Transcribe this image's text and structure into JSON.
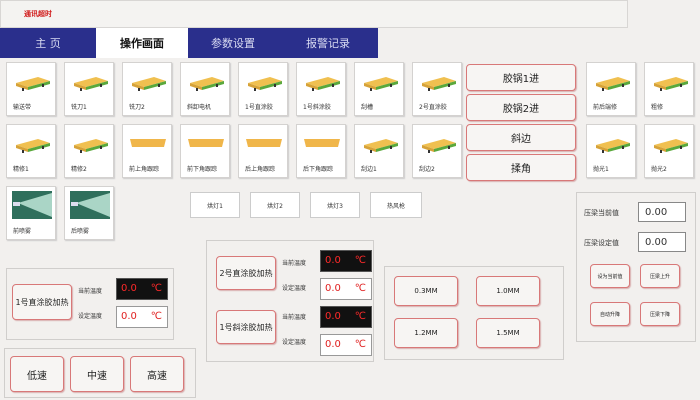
{
  "status": "通讯超时",
  "tabs": [
    "主 页",
    "操作画面",
    "参数设置",
    "报警记录"
  ],
  "tiles_row1": [
    "输送带",
    "铣刀1",
    "铣刀2",
    "斜卸电机",
    "1号直涂胶",
    "1号斜涂胶",
    "刮槽",
    "2号直涂胶"
  ],
  "tiles_row2": [
    "精修1",
    "精修2",
    "前上角跟踪",
    "前下角跟踪",
    "后上角跟踪",
    "后下角跟踪",
    "刮边1",
    "刮边2"
  ],
  "tiles_row3": [
    "前喷雾",
    "后喷雾"
  ],
  "tiles_right": [
    "前后端修",
    "粗修",
    "抛光1",
    "抛光2"
  ],
  "mid_buttons": [
    "胶锅1进",
    "胶锅2进",
    "斜边",
    "揉角"
  ],
  "small_buttons": [
    "烘灯1",
    "烘灯2",
    "烘灯3",
    "热风枪"
  ],
  "heater1": {
    "title": "1号直涂胶加热",
    "cur_label": "当前温度",
    "set_label": "设定温度",
    "cur": "0.0",
    "set": "0.0",
    "unit": "℃"
  },
  "heater2": {
    "title": "2号直涂胶加热",
    "cur_label": "当前温度",
    "set_label": "设定温度",
    "cur": "0.0",
    "set": "0.0",
    "unit": "℃"
  },
  "heater3": {
    "title": "1号斜涂胶加热",
    "cur_label": "当前温度",
    "set_label": "设定温度",
    "cur": "0.0",
    "set": "0.0",
    "unit": "℃"
  },
  "speed": [
    "低速",
    "中速",
    "高速"
  ],
  "thickness": [
    "0.3MM",
    "1.0MM",
    "1.2MM",
    "1.5MM"
  ],
  "pressure": {
    "cur_label": "压梁当前值",
    "cur": "0.00",
    "set_label": "压梁设定值",
    "set": "0.00",
    "buttons": [
      "设为当前值",
      "压梁上升",
      "自动升降",
      "压梁下降"
    ]
  },
  "colors": {
    "tab_bg": "#2a2f8c",
    "button_border": "#d87878",
    "readout": "#ff2a2a"
  }
}
